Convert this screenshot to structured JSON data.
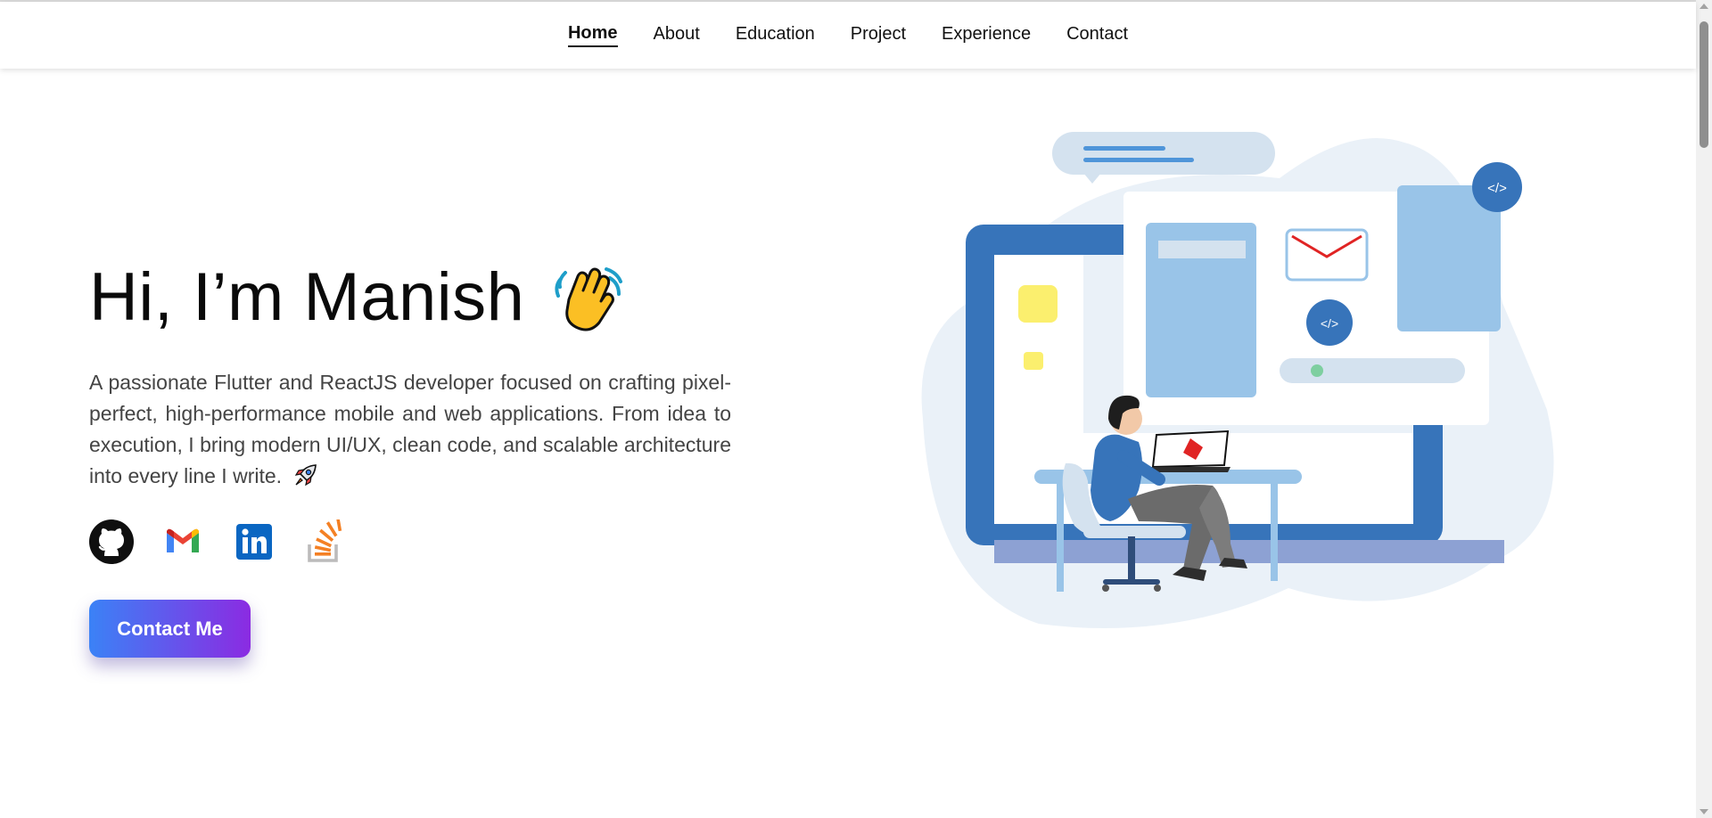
{
  "nav": {
    "items": [
      {
        "label": "Home",
        "active": true
      },
      {
        "label": "About",
        "active": false
      },
      {
        "label": "Education",
        "active": false
      },
      {
        "label": "Project",
        "active": false
      },
      {
        "label": "Experience",
        "active": false
      },
      {
        "label": "Contact",
        "active": false
      }
    ]
  },
  "hero": {
    "title": "Hi, I’m Manish",
    "title_icon": "waving-hand-icon",
    "description": "A passionate Flutter and ReactJS developer focused on crafting pixel-perfect, high-performance mobile and web applications. From idea to execution, I bring modern UI/UX, clean code, and scalable architecture into every line I write.",
    "description_icon": "rocket-icon",
    "contact_button": "Contact Me",
    "button_gradient": [
      "#3b82f6",
      "#8b2be2"
    ]
  },
  "socials": [
    {
      "icon": "github-icon"
    },
    {
      "icon": "gmail-icon"
    },
    {
      "icon": "linkedin-icon"
    },
    {
      "icon": "stackoverflow-icon"
    }
  ],
  "illustration": {
    "subject": "developer-at-desk-illustration"
  }
}
